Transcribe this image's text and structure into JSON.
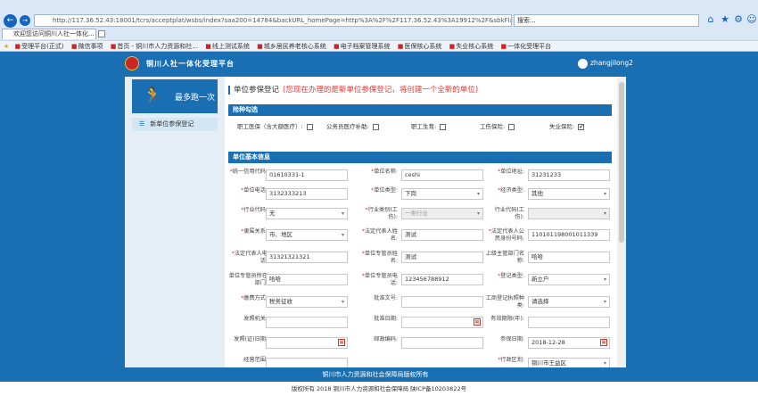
{
  "browser": {
    "address": "http://117.36.52.43:18001/tcrs/acceptplat/wsbs/index?saa200=14784&backURL_homePage=http%3A%2F%2F117.36.52.43%3A19912%2F&sbkFlag=1&u",
    "address_host": "117.36.52.43",
    "search_placeholder": "搜索...",
    "tab_title": "欢迎您访问铜川人社一体化...",
    "favorites": [
      "受理平台(正式)",
      "微信事项",
      "首页 - 铜川市人力资源和社...",
      "线上测试系统",
      "城乡居民养老核心系统",
      "电子档案管理系统",
      "医保核心系统",
      "失业核心系统",
      "一体化受理平台"
    ]
  },
  "header": {
    "title": "铜川人社一体化受理平台",
    "username": "zhangjilong2"
  },
  "sidebar": {
    "logo_text": "最多跑一次",
    "menu_item": "新单位参保登记"
  },
  "page": {
    "title": "单位参保登记",
    "note": "(您现在办理的是新单位参保登记，将创建一个全新的单位)",
    "section_insurance": "险种勾选",
    "insurance": [
      {
        "label": "职工医保（含大额医疗）:",
        "checked": false
      },
      {
        "label": "公务员医疗补助:",
        "checked": false
      },
      {
        "label": "职工生育:",
        "checked": false
      },
      {
        "label": "工伤保险:",
        "checked": false
      },
      {
        "label": "失业保险:",
        "checked": true
      }
    ],
    "section_basic": "单位基本信息"
  },
  "fields": [
    {
      "req": "*",
      "label": "统一信用代码:",
      "value": "01610331-1",
      "kind": "text"
    },
    {
      "req": "*",
      "label": "单位名称:",
      "value": "ceshi",
      "kind": "text"
    },
    {
      "req": "*",
      "label": "单位地址:",
      "value": "31231233",
      "kind": "text"
    },
    {
      "req": "*",
      "label": "单位电话:",
      "value": "3132333213",
      "kind": "text"
    },
    {
      "req": "*",
      "label": "单位类型:",
      "value": "下岗",
      "kind": "select"
    },
    {
      "req": "*",
      "label": "经济类型:",
      "value": "其他",
      "kind": "select"
    },
    {
      "req": "*",
      "label": "行业代码:",
      "value": "无",
      "kind": "select"
    },
    {
      "req": "*",
      "label": "行业类别(工伤):",
      "value": "一类行业",
      "kind": "disabled"
    },
    {
      "req": "",
      "label": "行业代码(工伤):",
      "value": "",
      "kind": "disabled"
    },
    {
      "req": "*",
      "label": "隶属关系:",
      "value": "市、地区",
      "kind": "select"
    },
    {
      "req": "*",
      "label": "法定代表人姓名:",
      "value": "测试",
      "kind": "text"
    },
    {
      "req": "*",
      "label": "法定代表人公民身份号码:",
      "value": "110101198001011339",
      "kind": "text"
    },
    {
      "req": "*",
      "label": "法定代表人电话:",
      "value": "31321321321",
      "kind": "text"
    },
    {
      "req": "*",
      "label": "单位专管员姓名:",
      "value": "测试",
      "kind": "text"
    },
    {
      "req": "",
      "label": "上级主管部门名称:",
      "value": "哈哈",
      "kind": "text"
    },
    {
      "req": "",
      "label": "单位专管员所在部门:",
      "value": "哈哈",
      "kind": "text"
    },
    {
      "req": "*",
      "label": "单位专管员电话:",
      "value": "123456788912",
      "kind": "text"
    },
    {
      "req": "*",
      "label": "登记类型:",
      "value": "新立户",
      "kind": "select"
    },
    {
      "req": "*",
      "label": "缴费方式:",
      "value": "税务征收",
      "kind": "select"
    },
    {
      "req": "",
      "label": "批准文号:",
      "value": "",
      "kind": "text"
    },
    {
      "req": "",
      "label": "工商登记执照种类:",
      "value": "请选择",
      "kind": "select"
    },
    {
      "req": "",
      "label": "发照机关:",
      "value": "",
      "kind": "text"
    },
    {
      "req": "",
      "label": "批准日期:",
      "value": "",
      "kind": "date"
    },
    {
      "req": "",
      "label": "有效期限(年):",
      "value": "",
      "kind": "text"
    },
    {
      "req": "",
      "label": "发照(证)日期:",
      "value": "",
      "kind": "date"
    },
    {
      "req": "",
      "label": "邮政编码:",
      "value": "",
      "kind": "text"
    },
    {
      "req": "",
      "label": "参保日期:",
      "value": "2018-12-28",
      "kind": "date"
    },
    {
      "req": "",
      "label": "经营范围:",
      "value": "",
      "kind": "text"
    },
    {
      "req": "",
      "label": "",
      "value": "",
      "kind": "none"
    },
    {
      "req": "*",
      "label": "行政区划:",
      "value": "铜川市王益区",
      "kind": "select"
    }
  ],
  "footer": {
    "org": "铜川市人力资源和社会保障局版权所有",
    "copyright": "版权所有 2018 铜川市人力资源和社会保障局 陕ICP备10203822号"
  }
}
